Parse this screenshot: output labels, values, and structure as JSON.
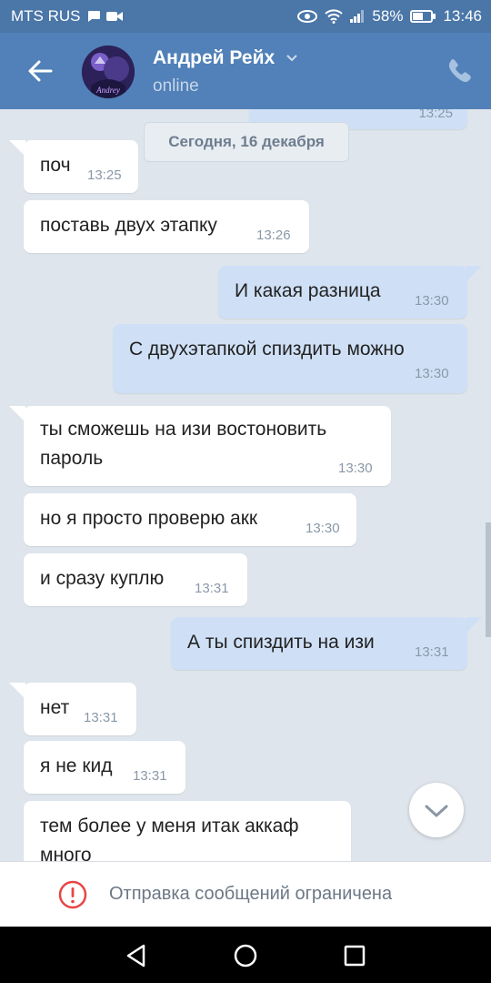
{
  "status_bar": {
    "carrier": "MTS RUS",
    "battery": "58%",
    "time": "13:46"
  },
  "header": {
    "contact_name": "Андрей Рейх",
    "presence": "online"
  },
  "colors": {
    "header": "#5181b8",
    "status_bar": "#4a76a8",
    "chat_bg": "#dfe5ec",
    "outgoing_bubble": "#cfe0f6",
    "incoming_bubble": "#ffffff"
  },
  "date_separator": "Сегодня, 16 декабря",
  "partial_top_message": {
    "time": "13:25"
  },
  "messages": [
    {
      "dir": "in",
      "text": "поч",
      "time": "13:25"
    },
    {
      "dir": "in",
      "text": "поставь двух этапку",
      "time": "13:26"
    },
    {
      "dir": "out",
      "text": "И какая разница",
      "time": "13:30"
    },
    {
      "dir": "out",
      "text": "С двухэтапкой спиздить можно",
      "time": "13:30"
    },
    {
      "dir": "in",
      "text": "ты сможешь на изи востоновить",
      "text2": "пароль",
      "time": "13:30"
    },
    {
      "dir": "in",
      "text": "но я просто проверю акк",
      "time": "13:30"
    },
    {
      "dir": "in",
      "text": "и сразу куплю",
      "time": "13:31"
    },
    {
      "dir": "out",
      "text": "А ты спиздить на изи",
      "time": "13:31"
    },
    {
      "dir": "in",
      "text": "нет",
      "time": "13:31"
    },
    {
      "dir": "in",
      "text": "я не кид",
      "time": "13:31"
    },
    {
      "dir": "in",
      "text": "тем более у меня итак аккаф",
      "text2": "много"
    }
  ],
  "restriction_notice": "Отправка сообщений ограничена",
  "icons": {
    "back": "arrow-left-icon",
    "call": "phone-icon",
    "scroll": "chevron-down-icon",
    "warning": "warning-circle-icon"
  }
}
